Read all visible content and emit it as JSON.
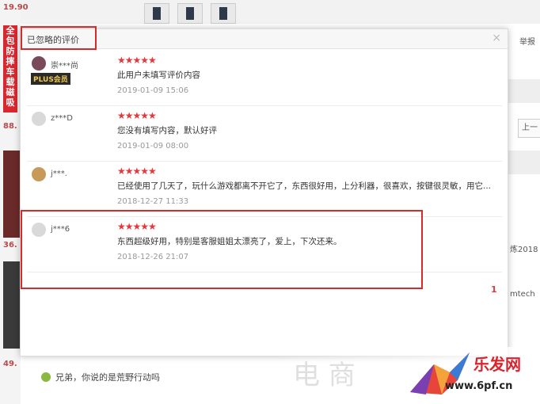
{
  "background": {
    "prices": [
      "19.90",
      "88.",
      "36.",
      "49."
    ],
    "promo_vertical": "全包防摔车载磁吸",
    "right_links": [
      "举报",
      "上一",
      "炼2018",
      "mtech"
    ],
    "footer_comment": "兄弟，你说的是荒野行动吗"
  },
  "modal": {
    "title": "已忽略的评价",
    "close_symbol": "×",
    "reviews": [
      {
        "user": "崇***尚",
        "badge": "PLUS会员",
        "stars": "★★★★★",
        "content": "此用户未填写评价内容",
        "date": "2019-01-09 15:06"
      },
      {
        "user": "z***D",
        "badge": "",
        "stars": "★★★★★",
        "content": "您没有填写内容，默认好评",
        "date": "2019-01-09 08:00"
      },
      {
        "user": "j***.",
        "badge": "",
        "stars": "★★★★★",
        "content": "已经使用了几天了，玩什么游戏都离不开它了，东西很好用，上分利器，很喜欢，按键很灵敏，用它...",
        "date": "2018-12-27 11:33"
      },
      {
        "user": "j***6",
        "badge": "",
        "stars": "★★★★★",
        "content": "东西超级好用，特别是客服姐姐太漂亮了，爱上，下次还来。",
        "date": "2018-12-26 21:07"
      }
    ],
    "page": "1"
  },
  "watermark": {
    "chars": "电 商",
    "brand": "乐发网",
    "url": "www.6pf.cn"
  },
  "colors": {
    "accent": "#e4393c",
    "highlight": "#d62b2b"
  }
}
